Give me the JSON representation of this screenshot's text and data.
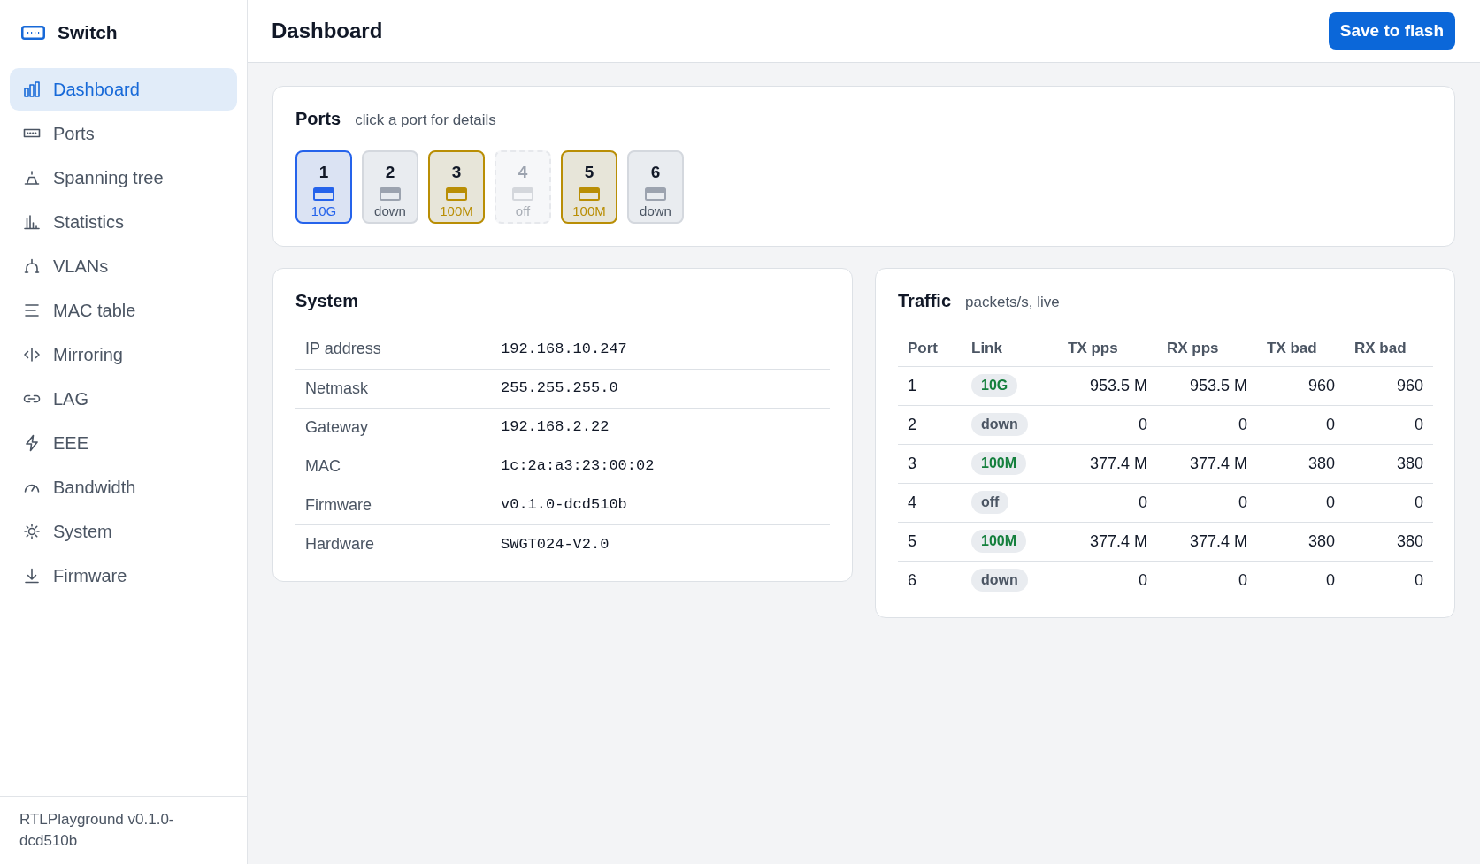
{
  "sidebar": {
    "brand": "Switch",
    "items": [
      {
        "label": "Dashboard",
        "selected": true
      },
      {
        "label": "Ports",
        "selected": false
      },
      {
        "label": "Spanning tree",
        "selected": false
      },
      {
        "label": "Statistics",
        "selected": false
      },
      {
        "label": "VLANs",
        "selected": false
      },
      {
        "label": "MAC table",
        "selected": false
      },
      {
        "label": "Mirroring",
        "selected": false
      },
      {
        "label": "LAG",
        "selected": false
      },
      {
        "label": "EEE",
        "selected": false
      },
      {
        "label": "Bandwidth",
        "selected": false
      },
      {
        "label": "System",
        "selected": false
      },
      {
        "label": "Firmware",
        "selected": false
      }
    ],
    "footer": "RTLPlayground v0.1.0-dcd510b"
  },
  "header": {
    "title": "Dashboard",
    "save_button": "Save to flash"
  },
  "ports_panel": {
    "title": "Ports",
    "hint": "click a port for details",
    "ports": [
      {
        "number": "1",
        "label": "10G",
        "kind": "tengig"
      },
      {
        "number": "2",
        "label": "down",
        "kind": "down"
      },
      {
        "number": "3",
        "label": "100M",
        "kind": "hundredmeg"
      },
      {
        "number": "4",
        "label": "off",
        "kind": "off"
      },
      {
        "number": "5",
        "label": "100M",
        "kind": "hundredmeg"
      },
      {
        "number": "6",
        "label": "down",
        "kind": "down"
      }
    ]
  },
  "system_panel": {
    "title": "System",
    "fields": [
      {
        "label": "IP address",
        "value": "192.168.10.247"
      },
      {
        "label": "Netmask",
        "value": "255.255.255.0"
      },
      {
        "label": "Gateway",
        "value": "192.168.2.22"
      },
      {
        "label": "MAC",
        "value": "1c:2a:a3:23:00:02"
      },
      {
        "label": "Firmware",
        "value": "v0.1.0-dcd510b"
      },
      {
        "label": "Hardware",
        "value": "SWGT024-V2.0"
      }
    ]
  },
  "traffic_panel": {
    "title": "Traffic",
    "hint": "packets/s, live",
    "columns": [
      "Port",
      "Link",
      "TX pps",
      "RX pps",
      "TX bad",
      "RX bad"
    ],
    "rows": [
      {
        "port": "1",
        "link": {
          "text": "10G",
          "kind": "up"
        },
        "tx_pps": "953.5 M",
        "rx_pps": "953.5 M",
        "tx_bad": "960",
        "rx_bad": "960"
      },
      {
        "port": "2",
        "link": {
          "text": "down",
          "kind": "down"
        },
        "tx_pps": "0",
        "rx_pps": "0",
        "tx_bad": "0",
        "rx_bad": "0"
      },
      {
        "port": "3",
        "link": {
          "text": "100M",
          "kind": "up"
        },
        "tx_pps": "377.4 M",
        "rx_pps": "377.4 M",
        "tx_bad": "380",
        "rx_bad": "380"
      },
      {
        "port": "4",
        "link": {
          "text": "off",
          "kind": "off"
        },
        "tx_pps": "0",
        "rx_pps": "0",
        "tx_bad": "0",
        "rx_bad": "0"
      },
      {
        "port": "5",
        "link": {
          "text": "100M",
          "kind": "up"
        },
        "tx_pps": "377.4 M",
        "rx_pps": "377.4 M",
        "tx_bad": "380",
        "rx_bad": "380"
      },
      {
        "port": "6",
        "link": {
          "text": "down",
          "kind": "down"
        },
        "tx_pps": "0",
        "rx_pps": "0",
        "tx_bad": "0",
        "rx_bad": "0"
      }
    ]
  }
}
